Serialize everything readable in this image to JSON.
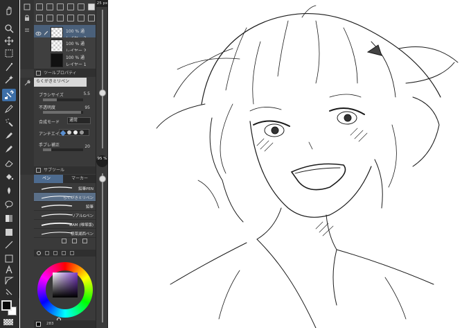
{
  "layers": [
    {
      "opacity": "100 %",
      "blend": "通",
      "name": "レイヤー 3",
      "selected": true
    },
    {
      "opacity": "100 %",
      "blend": "通",
      "name": "レイヤー 2",
      "selected": false
    },
    {
      "opacity": "100 %",
      "blend": "通",
      "name": "レイヤー 1",
      "selected": false
    }
  ],
  "tool_property": {
    "title": "ツールプロパティ",
    "brush_name": "らくがきミリペン",
    "brush_size_label": "ブラシサイズ",
    "brush_size_value": "5.5",
    "opacity_label": "不透明度",
    "opacity_value": "95",
    "blend_label": "合成モード",
    "blend_value": "通常",
    "antialias_label": "アンチエイリ",
    "stabilization_label": "手ブレ補正",
    "stabilization_value": "20"
  },
  "subtool": {
    "title": "サブツール",
    "tab_pen": "ペン",
    "tab_marker": "マーカー",
    "brushes": [
      {
        "name": "鉛筆PEN",
        "selected": false
      },
      {
        "name": "らくがきミリペン",
        "selected": true
      },
      {
        "name": "鉛筆",
        "selected": false
      },
      {
        "name": "リアルGペン",
        "selected": false
      },
      {
        "name": "ⅢAM (唯塚版)",
        "selected": false
      },
      {
        "name": "根菜湖西ペン",
        "selected": false
      }
    ]
  },
  "color": {
    "footer": "283"
  },
  "slider": {
    "top_label": "25 px",
    "badge_value": "95 %"
  },
  "colors": {
    "main": "#0a0a0a",
    "sub": "#ffffff",
    "panel_bg": "#3a3a3a",
    "selection": "#4a607a",
    "accent": "#3d6fa8"
  },
  "icons": [
    "hand-icon",
    "zoom-icon",
    "move-icon",
    "select-rect-icon",
    "lasso-icon",
    "magic-wand-icon",
    "eyedropper-icon",
    "pen-icon",
    "brush-icon",
    "airbrush-icon",
    "blend-icon",
    "eraser-icon",
    "fill-icon",
    "gradient-icon",
    "shape-icon",
    "text-icon",
    "frame-icon",
    "balloon-icon",
    "ruler-icon"
  ]
}
